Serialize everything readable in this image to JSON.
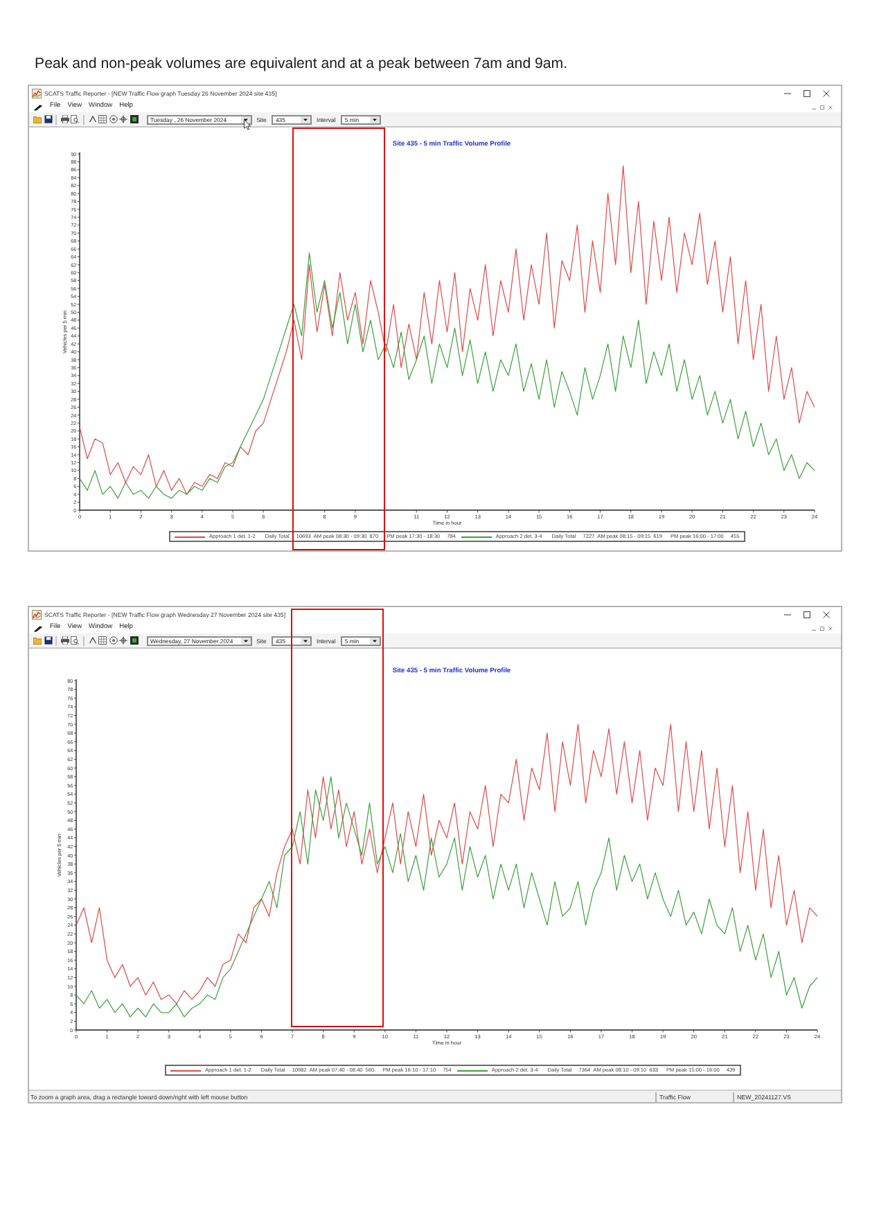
{
  "caption": "Peak and non-peak volumes are equivalent and at a peak between 7am and 9am.",
  "windows": [
    {
      "title": "SCATS Traffic Reporter - [NEW Traffic Flow graph Tuesday 26 November 2024 site 435]",
      "menu": [
        "File",
        "View",
        "Window",
        "Help"
      ],
      "toolbar": {
        "date": "Tuesday , 26 November 2024",
        "site_label": "Site",
        "site": "435",
        "interval_label": "Interval",
        "interval": "5 min",
        "pointer_over_date": true
      },
      "chart": {
        "chart_data": {
          "type": "line",
          "title": "Site 435 - 5 min Traffic Volume Profile",
          "xlabel": "Time in hour",
          "ylabel": "Vehicles per 5 min",
          "x": [
            0,
            0.25,
            0.5,
            0.75,
            1,
            1.25,
            1.5,
            1.75,
            2,
            2.25,
            2.5,
            2.75,
            3,
            3.25,
            3.5,
            3.75,
            4,
            4.25,
            4.5,
            4.75,
            5,
            5.25,
            5.5,
            5.75,
            6,
            6.25,
            6.5,
            6.75,
            7,
            7.25,
            7.5,
            7.75,
            8,
            8.25,
            8.5,
            8.75,
            9,
            9.25,
            9.5,
            9.75,
            10,
            10.25,
            10.5,
            10.75,
            11,
            11.25,
            11.5,
            11.75,
            12,
            12.25,
            12.5,
            12.75,
            13,
            13.25,
            13.5,
            13.75,
            14,
            14.25,
            14.5,
            14.75,
            15,
            15.25,
            15.5,
            15.75,
            16,
            16.25,
            16.5,
            16.75,
            17,
            17.25,
            17.5,
            17.75,
            18,
            18.25,
            18.5,
            18.75,
            19,
            19.25,
            19.5,
            19.75,
            20,
            20.25,
            20.5,
            20.75,
            21,
            21.25,
            21.5,
            21.75,
            22,
            22.25,
            22.5,
            22.75,
            23,
            23.25,
            23.5,
            23.75,
            24
          ],
          "xlim": [
            0,
            24
          ],
          "ylim": [
            0,
            90
          ],
          "xticks": [
            0,
            1,
            2,
            3,
            4,
            5,
            6,
            8,
            9,
            11,
            12,
            13,
            14,
            15,
            16,
            17,
            18,
            19,
            20,
            21,
            22,
            23,
            24
          ],
          "yticks": [
            0,
            2,
            4,
            6,
            8,
            10,
            12,
            14,
            16,
            18,
            20,
            22,
            24,
            26,
            28,
            30,
            32,
            34,
            36,
            38,
            40,
            42,
            44,
            46,
            48,
            50,
            52,
            54,
            56,
            58,
            60,
            62,
            64,
            66,
            68,
            70,
            72,
            74,
            76,
            78,
            80,
            82,
            84,
            86,
            88,
            90
          ],
          "series": [
            {
              "name": "Approach 1 det. 1-2",
              "color": "#e04848",
              "values": [
                21,
                13,
                18,
                17,
                9,
                12,
                7,
                11,
                9,
                14,
                6,
                10,
                5,
                8,
                4,
                7,
                6,
                9,
                8,
                12,
                11,
                16,
                14,
                20,
                22,
                28,
                34,
                40,
                48,
                38,
                62,
                45,
                57,
                44,
                60,
                48,
                55,
                42,
                58,
                50,
                40,
                52,
                36,
                47,
                38,
                55,
                42,
                58,
                45,
                60,
                40,
                56,
                48,
                62,
                44,
                58,
                50,
                66,
                48,
                62,
                52,
                70,
                46,
                63,
                58,
                72,
                50,
                68,
                55,
                80,
                62,
                87,
                60,
                78,
                52,
                73,
                58,
                74,
                55,
                70,
                62,
                75,
                57,
                68,
                50,
                64,
                42,
                58,
                38,
                52,
                30,
                44,
                28,
                36,
                22,
                30,
                26
              ]
            },
            {
              "name": "Approach 2 det. 3-4",
              "color": "#3aa03a",
              "values": [
                8,
                5,
                10,
                4,
                6,
                3,
                7,
                4,
                5,
                3,
                6,
                4,
                3,
                5,
                4,
                6,
                5,
                8,
                7,
                11,
                12,
                16,
                20,
                24,
                28,
                34,
                40,
                46,
                52,
                44,
                65,
                50,
                58,
                46,
                55,
                42,
                52,
                40,
                48,
                38,
                42,
                36,
                45,
                33,
                38,
                44,
                32,
                42,
                36,
                46,
                34,
                43,
                32,
                40,
                30,
                38,
                34,
                42,
                30,
                37,
                28,
                38,
                26,
                35,
                30,
                24,
                36,
                28,
                34,
                42,
                30,
                44,
                36,
                48,
                32,
                40,
                34,
                42,
                30,
                38,
                28,
                34,
                24,
                30,
                22,
                28,
                18,
                25,
                16,
                22,
                14,
                18,
                10,
                14,
                8,
                12,
                10
              ]
            }
          ]
        },
        "legend": [
          {
            "daily_total_label": "Daily Total",
            "daily_total": "10693",
            "am_peak": "AM peak 08:30 - 09:30",
            "am_peak_volume": "870",
            "pm_peak": "PM peak 17:30 - 18:30",
            "pm_peak_volume": "784"
          },
          {
            "daily_total_label": "Daily Total",
            "daily_total": "7227",
            "am_peak": "AM peak 08:15 - 09:15",
            "am_peak_volume": "619",
            "pm_peak": "PM peak 16:00 - 17:00",
            "pm_peak_volume": "455"
          }
        ]
      }
    },
    {
      "title": "SCATS Traffic Reporter - [NEW Traffic Flow graph Wednesday 27 November 2024 site 435]",
      "menu": [
        "File",
        "View",
        "Window",
        "Help"
      ],
      "toolbar": {
        "date": "Wednesday, 27 November 2024",
        "site_label": "Site",
        "site": "435",
        "interval_label": "Interval",
        "interval": "5 min"
      },
      "chart": {
        "chart_data": {
          "type": "line",
          "title": "Site 435 - 5 min Traffic Volume Profile",
          "xlabel": "Time in hour",
          "ylabel": "Vehicles per 5 min",
          "x": [
            0,
            0.25,
            0.5,
            0.75,
            1,
            1.25,
            1.5,
            1.75,
            2,
            2.25,
            2.5,
            2.75,
            3,
            3.25,
            3.5,
            3.75,
            4,
            4.25,
            4.5,
            4.75,
            5,
            5.25,
            5.5,
            5.75,
            6,
            6.25,
            6.5,
            6.75,
            7,
            7.25,
            7.5,
            7.75,
            8,
            8.25,
            8.5,
            8.75,
            9,
            9.25,
            9.5,
            9.75,
            10,
            10.25,
            10.5,
            10.75,
            11,
            11.25,
            11.5,
            11.75,
            12,
            12.25,
            12.5,
            12.75,
            13,
            13.25,
            13.5,
            13.75,
            14,
            14.25,
            14.5,
            14.75,
            15,
            15.25,
            15.5,
            15.75,
            16,
            16.25,
            16.5,
            16.75,
            17,
            17.25,
            17.5,
            17.75,
            18,
            18.25,
            18.5,
            18.75,
            19,
            19.25,
            19.5,
            19.75,
            20,
            20.25,
            20.5,
            20.75,
            21,
            21.25,
            21.5,
            21.75,
            22,
            22.25,
            22.5,
            22.75,
            23,
            23.25,
            23.5,
            23.75,
            24
          ],
          "xlim": [
            0,
            24
          ],
          "ylim": [
            0,
            80
          ],
          "xticks": [
            0,
            1,
            2,
            3,
            4,
            5,
            6,
            7,
            8,
            9,
            10,
            11,
            12,
            13,
            14,
            15,
            16,
            17,
            18,
            19,
            20,
            21,
            22,
            23,
            24
          ],
          "yticks": [
            0,
            2,
            4,
            6,
            8,
            10,
            12,
            14,
            16,
            18,
            20,
            22,
            24,
            26,
            28,
            30,
            32,
            34,
            36,
            38,
            40,
            42,
            44,
            46,
            48,
            50,
            52,
            54,
            56,
            58,
            60,
            62,
            64,
            66,
            68,
            70,
            72,
            74,
            76,
            78,
            80
          ],
          "series": [
            {
              "name": "Approach 1 det. 1-2",
              "color": "#e04848",
              "values": [
                24,
                28,
                20,
                28,
                16,
                12,
                15,
                10,
                12,
                8,
                11,
                7,
                8,
                6,
                9,
                7,
                9,
                12,
                10,
                15,
                16,
                22,
                20,
                28,
                30,
                26,
                36,
                42,
                46,
                38,
                55,
                44,
                58,
                46,
                55,
                42,
                50,
                38,
                46,
                36,
                44,
                52,
                38,
                50,
                42,
                54,
                40,
                48,
                44,
                52,
                38,
                50,
                46,
                56,
                42,
                54,
                52,
                62,
                48,
                60,
                55,
                68,
                50,
                66,
                56,
                70,
                52,
                64,
                58,
                69,
                54,
                66,
                52,
                64,
                48,
                60,
                56,
                70,
                50,
                66,
                50,
                64,
                46,
                60,
                42,
                56,
                36,
                50,
                32,
                46,
                28,
                40,
                24,
                32,
                20,
                28,
                26
              ]
            },
            {
              "name": "Approach 2 det. 3-4",
              "color": "#3aa03a",
              "values": [
                8,
                6,
                9,
                5,
                7,
                4,
                6,
                3,
                5,
                3,
                6,
                4,
                4,
                6,
                3,
                5,
                6,
                8,
                7,
                12,
                14,
                18,
                22,
                26,
                30,
                34,
                28,
                40,
                42,
                50,
                38,
                55,
                48,
                58,
                44,
                52,
                46,
                40,
                52,
                38,
                42,
                36,
                45,
                34,
                40,
                32,
                44,
                35,
                38,
                44,
                32,
                42,
                35,
                40,
                30,
                38,
                32,
                38,
                28,
                36,
                30,
                24,
                34,
                26,
                28,
                34,
                24,
                32,
                36,
                44,
                32,
                40,
                34,
                38,
                30,
                36,
                30,
                26,
                32,
                24,
                27,
                22,
                30,
                24,
                22,
                28,
                18,
                24,
                16,
                22,
                12,
                18,
                8,
                12,
                5,
                10,
                12
              ]
            }
          ]
        },
        "legend": [
          {
            "daily_total_label": "Daily Total",
            "daily_total": "10982",
            "am_peak": "AM peak 07:40 - 08:40",
            "am_peak_volume": "560",
            "pm_peak": "PM peak 16:10 - 17:10",
            "pm_peak_volume": "754"
          },
          {
            "daily_total_label": "Daily Total",
            "daily_total": "7364",
            "am_peak": "AM peak 08:10 - 09:10",
            "am_peak_volume": "633",
            "pm_peak": "PM peak 15:00 - 16:00",
            "pm_peak_volume": "439"
          }
        ]
      },
      "status_bar": {
        "message": "To zoom a graph area, drag a rectangle toward down/right with left mouse button",
        "panels": [
          "Traffic Flow",
          "NEW_20241127.VS"
        ]
      }
    }
  ]
}
